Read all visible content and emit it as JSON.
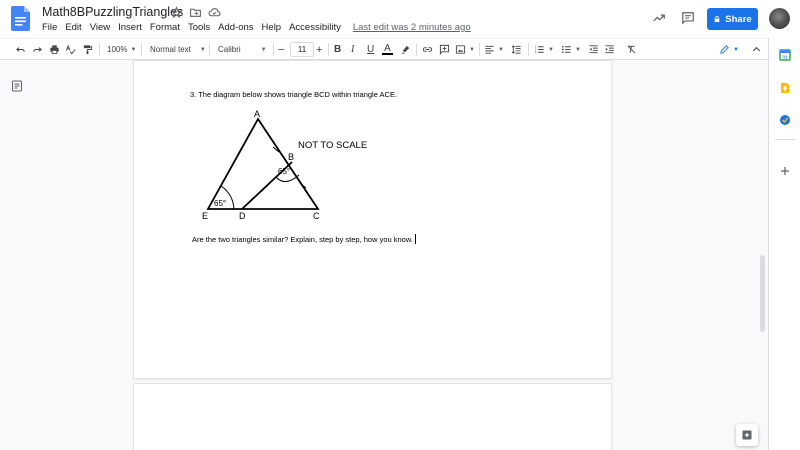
{
  "doc": {
    "title": "Math8BPuzzlingTriangles",
    "last_edit": "Last edit was 2 minutes ago"
  },
  "menu": [
    "File",
    "Edit",
    "View",
    "Insert",
    "Format",
    "Tools",
    "Add-ons",
    "Help",
    "Accessibility"
  ],
  "share": {
    "label": "Share"
  },
  "toolbar": {
    "zoom": "100%",
    "style": "Normal text",
    "font": "Calibri",
    "font_size": "11"
  },
  "content": {
    "question": "3. The diagram below shows triangle BCD within triangle ACE.",
    "answer": "Are the two triangles similar? Explain, step by step, how you know."
  },
  "diagram": {
    "label_a": "A",
    "label_b": "B",
    "label_c": "C",
    "label_d": "D",
    "label_e": "E",
    "angle_b": "65°",
    "angle_e": "65°",
    "note": "NOT TO SCALE"
  },
  "colors": {
    "share_blue": "#1a73e8",
    "docs_blue": "#4285f4",
    "keep_yellow": "#fbbc04",
    "tasks_blue": "#1a73e8"
  }
}
